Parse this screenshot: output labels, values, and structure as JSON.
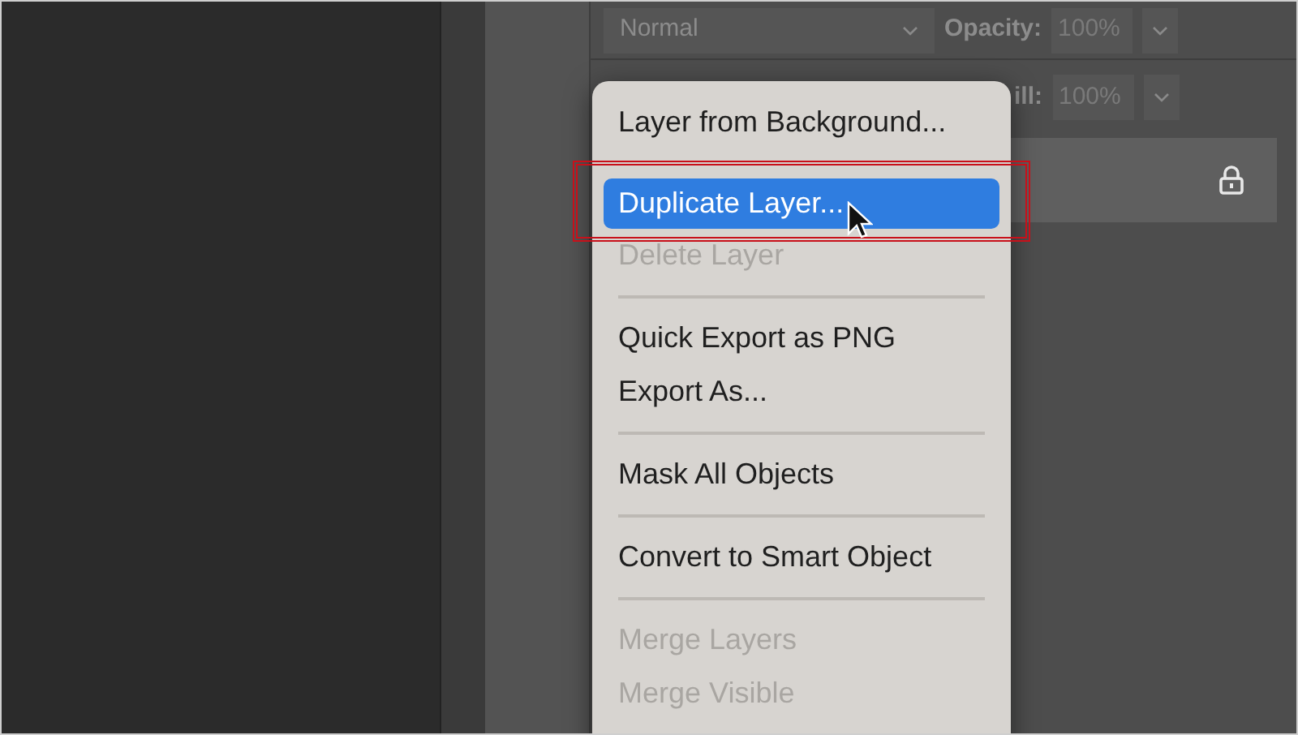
{
  "layers_panel": {
    "blend_mode": "Normal",
    "opacity_label": "Opacity:",
    "opacity_value": "100%",
    "fill_label": "ill:",
    "fill_value": "100%"
  },
  "context_menu": {
    "items": [
      {
        "kind": "item",
        "label": "Layer from Background...",
        "disabled": false,
        "selected": false
      },
      {
        "kind": "item",
        "label": "Duplicate Layer...",
        "disabled": false,
        "selected": true
      },
      {
        "kind": "item",
        "label": "Delete Layer",
        "disabled": true,
        "selected": false
      },
      {
        "kind": "separator"
      },
      {
        "kind": "item",
        "label": "Quick Export as PNG",
        "disabled": false,
        "selected": false
      },
      {
        "kind": "item",
        "label": "Export As...",
        "disabled": false,
        "selected": false
      },
      {
        "kind": "separator"
      },
      {
        "kind": "item",
        "label": "Mask All Objects",
        "disabled": false,
        "selected": false
      },
      {
        "kind": "separator"
      },
      {
        "kind": "item",
        "label": "Convert to Smart Object",
        "disabled": false,
        "selected": false
      },
      {
        "kind": "separator"
      },
      {
        "kind": "item",
        "label": "Merge Layers",
        "disabled": true,
        "selected": false
      },
      {
        "kind": "item",
        "label": "Merge Visible",
        "disabled": true,
        "selected": false
      }
    ]
  }
}
